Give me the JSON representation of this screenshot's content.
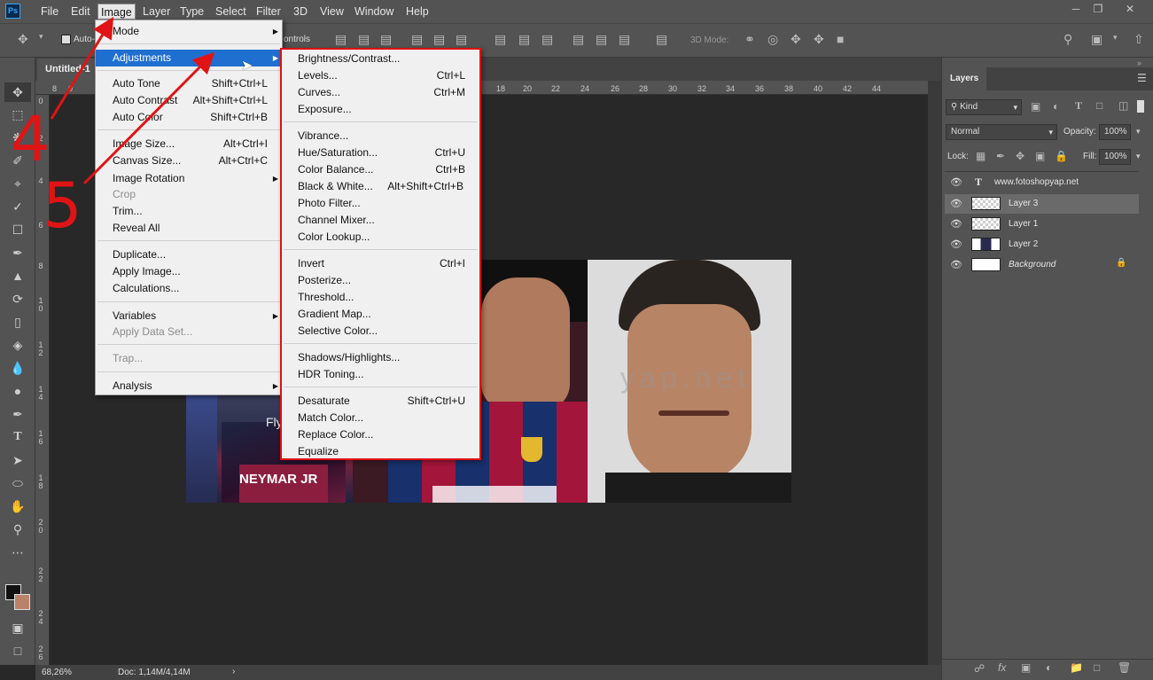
{
  "menubar": {
    "items": [
      "File",
      "Edit",
      "Image",
      "Layer",
      "Type",
      "Select",
      "Filter",
      "3D",
      "View",
      "Window",
      "Help"
    ],
    "active": "Image"
  },
  "options": {
    "auto_label": "Auto-",
    "controls_label": "ontrols",
    "mode3d_label": "3D Mode:"
  },
  "document": {
    "tab_title": "Untitled-1",
    "zoom": "68,26%",
    "doc_info": "Doc: 1,14M/4,14M",
    "watermark": "yap.net"
  },
  "ruler": {
    "top": [
      "8",
      "0",
      "18",
      "20",
      "22",
      "24",
      "26",
      "28",
      "30",
      "32",
      "34",
      "36",
      "38",
      "40",
      "42",
      "44"
    ],
    "left": [
      "0",
      "2",
      "4",
      "6",
      "8",
      "1 0",
      "1 2",
      "1 4",
      "1 6",
      "1 8",
      "2 0",
      "2 2",
      "2 4",
      "2 6"
    ]
  },
  "image_menu": {
    "items": [
      {
        "label": "Mode",
        "sub": true
      },
      {
        "sep": true
      },
      {
        "label": "Adjustments",
        "sub": true,
        "highlight": true
      },
      {
        "sep": true
      },
      {
        "label": "Auto Tone",
        "shortcut": "Shift+Ctrl+L"
      },
      {
        "label": "Auto Contrast",
        "shortcut": "Alt+Shift+Ctrl+L"
      },
      {
        "label": "Auto Color",
        "shortcut": "Shift+Ctrl+B"
      },
      {
        "sep": true
      },
      {
        "label": "Image Size...",
        "shortcut": "Alt+Ctrl+I"
      },
      {
        "label": "Canvas Size...",
        "shortcut": "Alt+Ctrl+C"
      },
      {
        "label": "Image Rotation",
        "sub": true
      },
      {
        "label": "Crop",
        "disabled": true
      },
      {
        "label": "Trim..."
      },
      {
        "label": "Reveal All"
      },
      {
        "sep": true
      },
      {
        "label": "Duplicate..."
      },
      {
        "label": "Apply Image..."
      },
      {
        "label": "Calculations..."
      },
      {
        "sep": true
      },
      {
        "label": "Variables",
        "sub": true
      },
      {
        "label": "Apply Data Set...",
        "disabled": true
      },
      {
        "sep": true
      },
      {
        "label": "Trap...",
        "disabled": true
      },
      {
        "sep": true
      },
      {
        "label": "Analysis",
        "sub": true
      }
    ]
  },
  "adjust_menu": {
    "items": [
      {
        "label": "Brightness/Contrast..."
      },
      {
        "label": "Levels...",
        "shortcut": "Ctrl+L"
      },
      {
        "label": "Curves...",
        "shortcut": "Ctrl+M"
      },
      {
        "label": "Exposure..."
      },
      {
        "sep": true
      },
      {
        "label": "Vibrance..."
      },
      {
        "label": "Hue/Saturation...",
        "shortcut": "Ctrl+U"
      },
      {
        "label": "Color Balance...",
        "shortcut": "Ctrl+B"
      },
      {
        "label": "Black & White...",
        "shortcut": "Alt+Shift+Ctrl+B"
      },
      {
        "label": "Photo Filter..."
      },
      {
        "label": "Channel Mixer..."
      },
      {
        "label": "Color Lookup..."
      },
      {
        "sep": true
      },
      {
        "label": "Invert",
        "shortcut": "Ctrl+I"
      },
      {
        "label": "Posterize..."
      },
      {
        "label": "Threshold..."
      },
      {
        "label": "Gradient Map..."
      },
      {
        "label": "Selective Color..."
      },
      {
        "sep": true
      },
      {
        "label": "Shadows/Highlights..."
      },
      {
        "label": "HDR Toning..."
      },
      {
        "sep": true
      },
      {
        "label": "Desaturate",
        "shortcut": "Shift+Ctrl+U"
      },
      {
        "label": "Match Color..."
      },
      {
        "label": "Replace Color..."
      },
      {
        "label": "Equalize"
      }
    ]
  },
  "annotations": {
    "step4": "4",
    "step5": "5"
  },
  "layers_panel": {
    "tab": "Layers",
    "kind": "Kind",
    "blend_mode": "Normal",
    "opacity_label": "Opacity:",
    "opacity": "100%",
    "lock_label": "Lock:",
    "fill_label": "Fill:",
    "fill": "100%",
    "layers": [
      {
        "name": "www.fotoshopyap.net",
        "type": "text"
      },
      {
        "name": "Layer 3",
        "selected": true
      },
      {
        "name": "Layer 1"
      },
      {
        "name": "Layer 2"
      },
      {
        "name": "Background",
        "italic": true,
        "locked": true
      }
    ]
  },
  "photo_text": {
    "jersey": "NEYMAR JR",
    "sponsor": "Fly Emira"
  }
}
